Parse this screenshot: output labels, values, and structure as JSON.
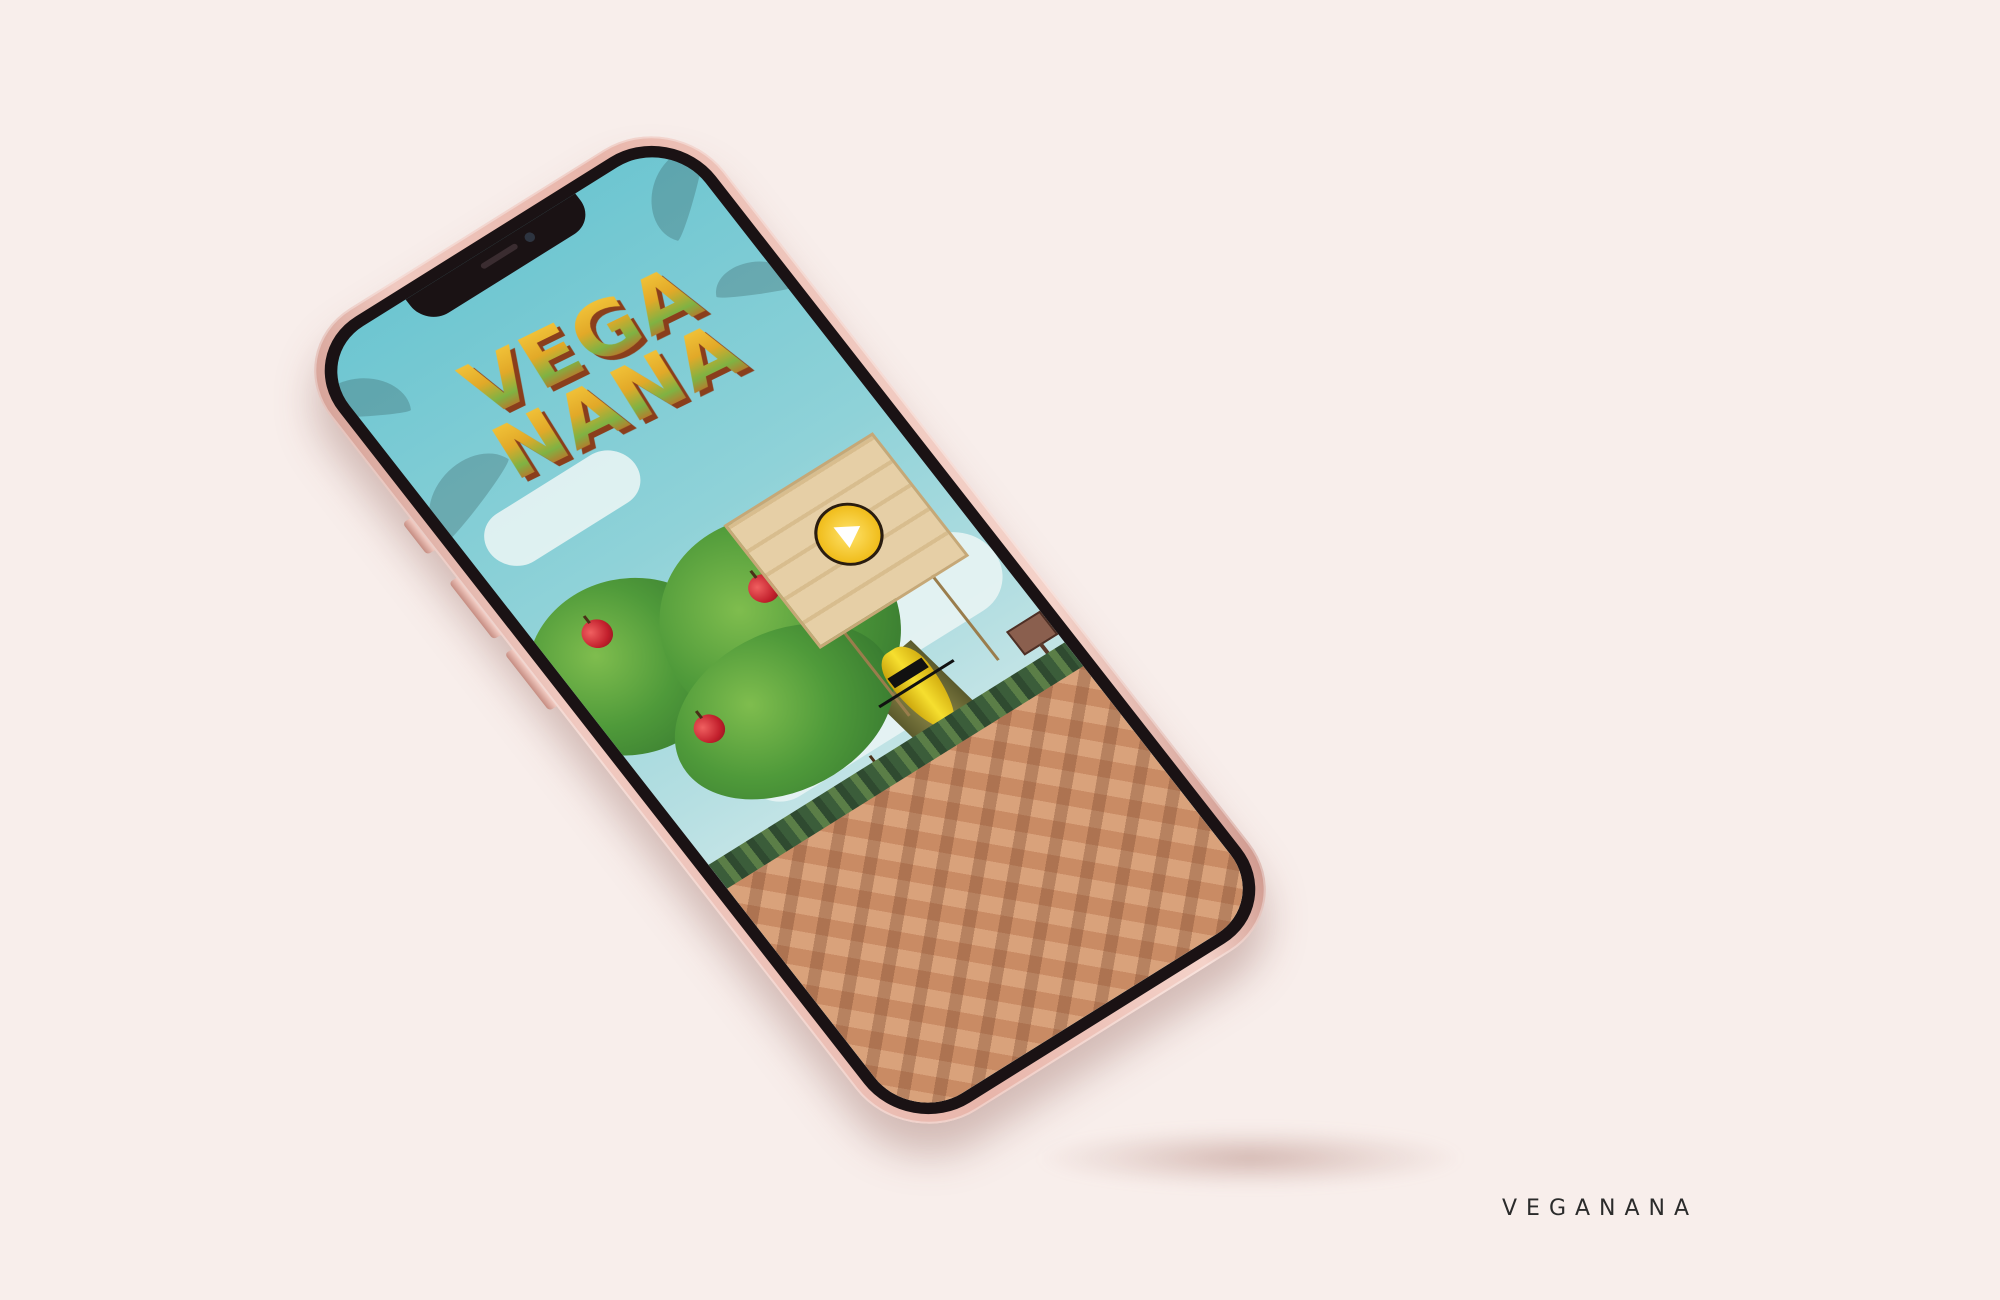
{
  "caption": "VEGANANA",
  "game": {
    "title_line1": "VEGA",
    "title_line2": "NANA",
    "play_icon": "play-icon"
  },
  "colors": {
    "background": "#f8eeeb",
    "phone_body": "#ebb9ae",
    "sky": "#8fd2d8",
    "ground": "#d39a73"
  }
}
